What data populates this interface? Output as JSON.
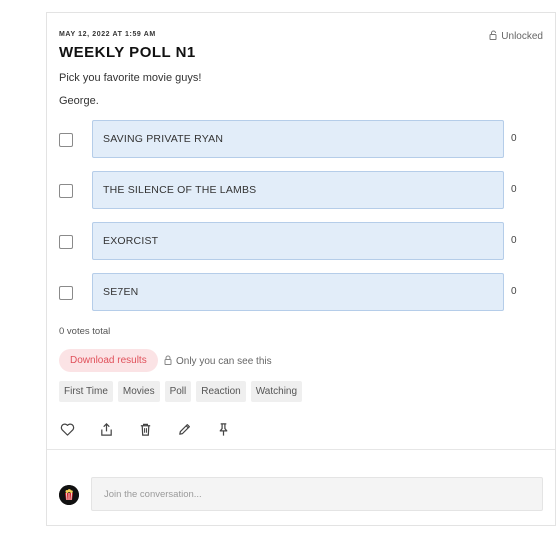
{
  "post": {
    "date": "MAY 12, 2022 AT 1:59 AM",
    "lock_status": "Unlocked",
    "title": "WEEKLY POLL N1",
    "description": "Pick you favorite movie guys!",
    "author": "George."
  },
  "poll": {
    "options": [
      {
        "label": "SAVING PRIVATE RYAN",
        "count": "0"
      },
      {
        "label": "THE SILENCE OF THE LAMBS",
        "count": "0"
      },
      {
        "label": "EXORCIST",
        "count": "0"
      },
      {
        "label": "SE7EN",
        "count": "0"
      }
    ],
    "votes_total": "0 votes total",
    "download_label": "Download results",
    "visibility_note": "Only you can see this"
  },
  "tags": [
    "First Time",
    "Movies",
    "Poll",
    "Reaction",
    "Watching"
  ],
  "actions": [
    "heart-icon",
    "share-icon",
    "trash-icon",
    "pencil-icon",
    "pin-icon"
  ],
  "comment": {
    "placeholder": "Join the conversation..."
  },
  "colors": {
    "option_bg": "#e2edf9",
    "option_border": "#b5cde9",
    "download_bg": "#fbe3e5",
    "download_text": "#e0505a"
  }
}
